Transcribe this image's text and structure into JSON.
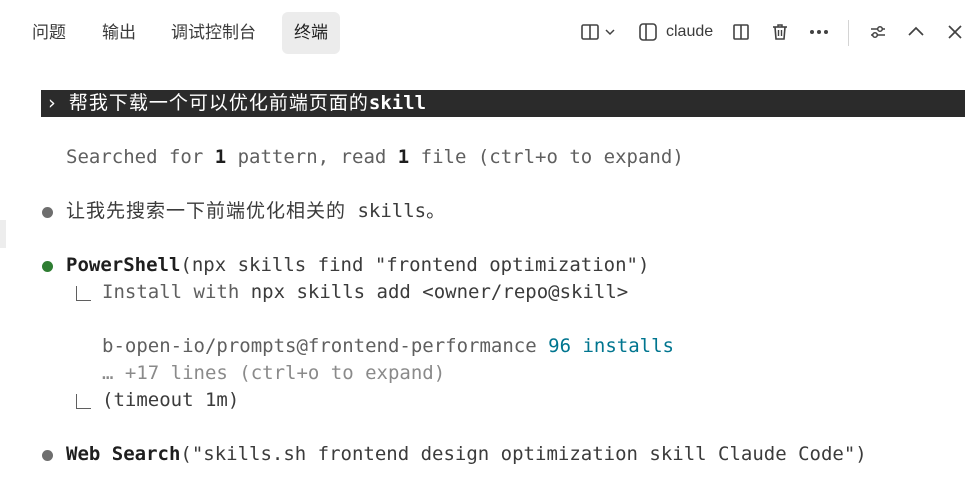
{
  "tabs": [
    {
      "label": "问题",
      "active": false
    },
    {
      "label": "输出",
      "active": false
    },
    {
      "label": "调试控制台",
      "active": false
    },
    {
      "label": "终端",
      "active": true
    }
  ],
  "toolbar": {
    "terminal_name": "claude",
    "icons": [
      "split-layout-icon",
      "chevron-down-icon",
      "terminal-panel-icon",
      "split-terminal-icon",
      "trash-icon",
      "more-icon",
      "settings-sliders-icon",
      "chevron-up-icon",
      "close-icon"
    ]
  },
  "terminal": {
    "prompt_marker": "›",
    "prompt_text_cn": "帮我下载一个可以优化前端页面的",
    "prompt_text_en": "skill",
    "searched": {
      "prefix": "Searched for ",
      "count1": "1",
      "middle": " pattern, read ",
      "count2": "1",
      "suffix": " file (ctrl+o to expand)"
    },
    "message": {
      "cn": "让我先搜索一下前端优化相关的",
      "en": " skills",
      "end": "。"
    },
    "powershell": {
      "tool": "PowerShell",
      "args": "(npx skills find \"frontend optimization\")",
      "install_prefix": "Install with ",
      "install_cmd": "npx skills add <owner/repo@skill>",
      "result_pkg": "b-open-io/prompts@frontend-performance",
      "result_installs": "96 installs",
      "more": "… +17 lines (ctrl+o to expand)",
      "timeout": "(timeout 1m)"
    },
    "websearch": {
      "tool": "Web Search",
      "args": "(\"skills.sh frontend design optimization skill Claude Code\")"
    }
  },
  "colors": {
    "prompt_bg": "#2b2b2b",
    "active_tab_bg": "#ececec",
    "success_green": "#2e7d32",
    "accent_teal": "#00758f"
  }
}
